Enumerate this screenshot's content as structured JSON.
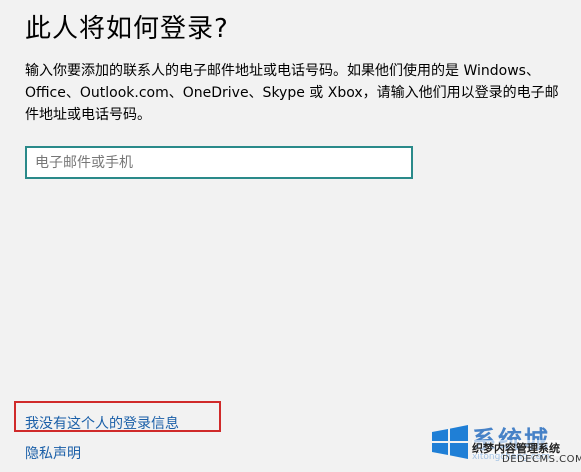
{
  "page": {
    "title": "此人将如何登录?",
    "description": "输入你要添加的联系人的电子邮件地址或电话号码。如果他们使用的是 Windows、Office、Outlook.com、OneDrive、Skype 或 Xbox，请输入他们用以登录的电子邮件地址或电话号码。"
  },
  "form": {
    "email_placeholder": "电子邮件或手机",
    "email_value": ""
  },
  "links": {
    "no_signin_info": "我没有这个人的登录信息",
    "privacy": "隐私声明"
  },
  "watermark": {
    "brand": "系统城",
    "sub": "织梦内容管理系统",
    "domain": "DEDECMS.COM",
    "url": "xitongcheng.com"
  },
  "colors": {
    "background": "#f2f2f2",
    "input_border": "#2a8a8a",
    "link": "#1a5fa8",
    "highlight": "#d02a2a"
  }
}
